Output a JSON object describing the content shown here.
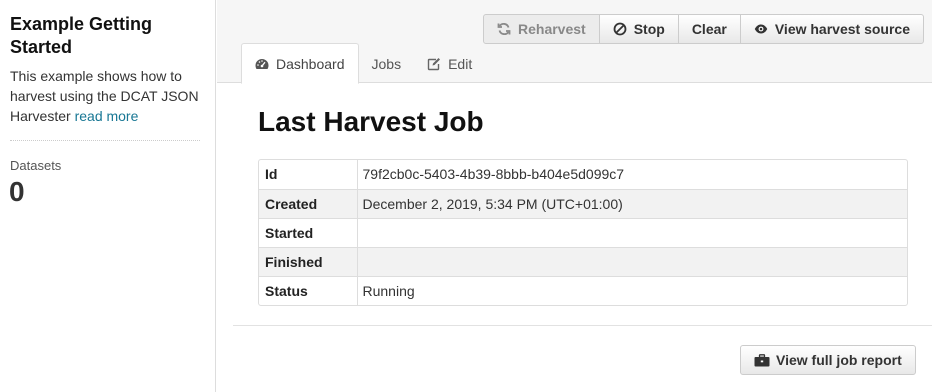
{
  "sidebar": {
    "title": "Example Getting Started",
    "description": "This example shows how to harvest using the DCAT JSON Harvester",
    "read_more_label": "read more",
    "stat_label": "Datasets",
    "stat_value": "0"
  },
  "toolbar": {
    "reharvest_label": "Reharvest",
    "stop_label": "Stop",
    "clear_label": "Clear",
    "view_source_label": "View harvest source"
  },
  "tabs": [
    {
      "label": "Dashboard",
      "icon": "dashboard-icon",
      "active": true
    },
    {
      "label": "Jobs",
      "icon": "",
      "active": false
    },
    {
      "label": "Edit",
      "icon": "edit-icon",
      "active": false
    }
  ],
  "main": {
    "title": "Last Harvest Job",
    "rows": [
      {
        "label": "Id",
        "value": "79f2cb0c-5403-4b39-8bbb-b404e5d099c7"
      },
      {
        "label": "Created",
        "value": "December 2, 2019, 5:34 PM (UTC+01:00)"
      },
      {
        "label": "Started",
        "value": ""
      },
      {
        "label": "Finished",
        "value": ""
      },
      {
        "label": "Status",
        "value": "Running"
      }
    ],
    "report_button_label": "View full job report"
  },
  "colors": {
    "link": "#187794",
    "header_bg": "#f6f6f6",
    "border": "#dddddd"
  }
}
